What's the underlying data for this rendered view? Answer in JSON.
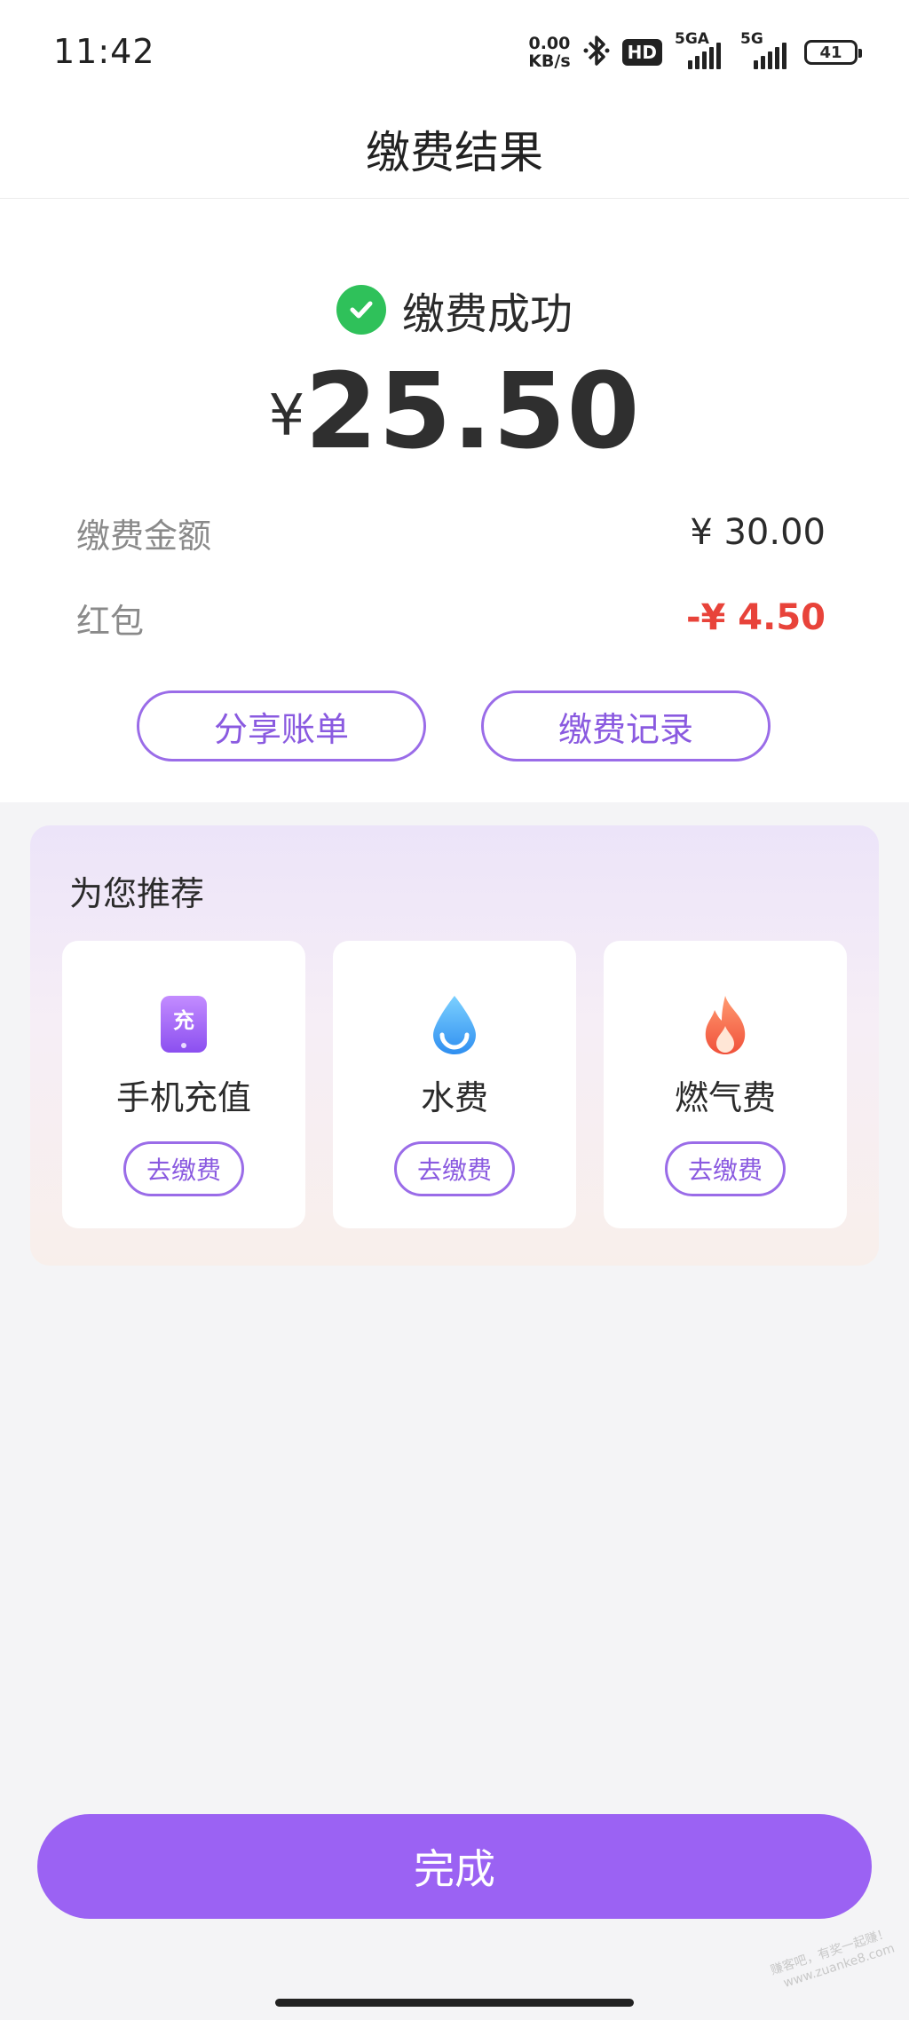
{
  "status_bar": {
    "time": "11:42",
    "net_speed_value": "0.00",
    "net_speed_unit": "KB/s",
    "hd_label": "HD",
    "signal1_label": "5GA",
    "signal2_label": "5G",
    "battery": "41"
  },
  "header": {
    "title": "缴费结果"
  },
  "result": {
    "status_text": "缴费成功",
    "currency": "¥",
    "amount": "25.50",
    "rows": [
      {
        "label": "缴费金额",
        "value": "¥ 30.00"
      },
      {
        "label": "红包",
        "value": "-¥ 4.50"
      }
    ],
    "share_button": "分享账单",
    "records_button": "缴费记录"
  },
  "recommend": {
    "title": "为您推荐",
    "items": [
      {
        "name": "手机充值",
        "icon": "phone-recharge-icon",
        "icon_char": "充",
        "button": "去缴费"
      },
      {
        "name": "水费",
        "icon": "water-drop-icon",
        "button": "去缴费"
      },
      {
        "name": "燃气费",
        "icon": "gas-flame-icon",
        "button": "去缴费"
      }
    ]
  },
  "footer": {
    "done_button": "完成"
  },
  "watermark": {
    "line1": "赚客吧，有奖一起赚！",
    "line2": "www.zuanke8.com"
  },
  "colors": {
    "accent": "#9b62f3",
    "success": "#2fc15a",
    "discount": "#e8433a"
  }
}
